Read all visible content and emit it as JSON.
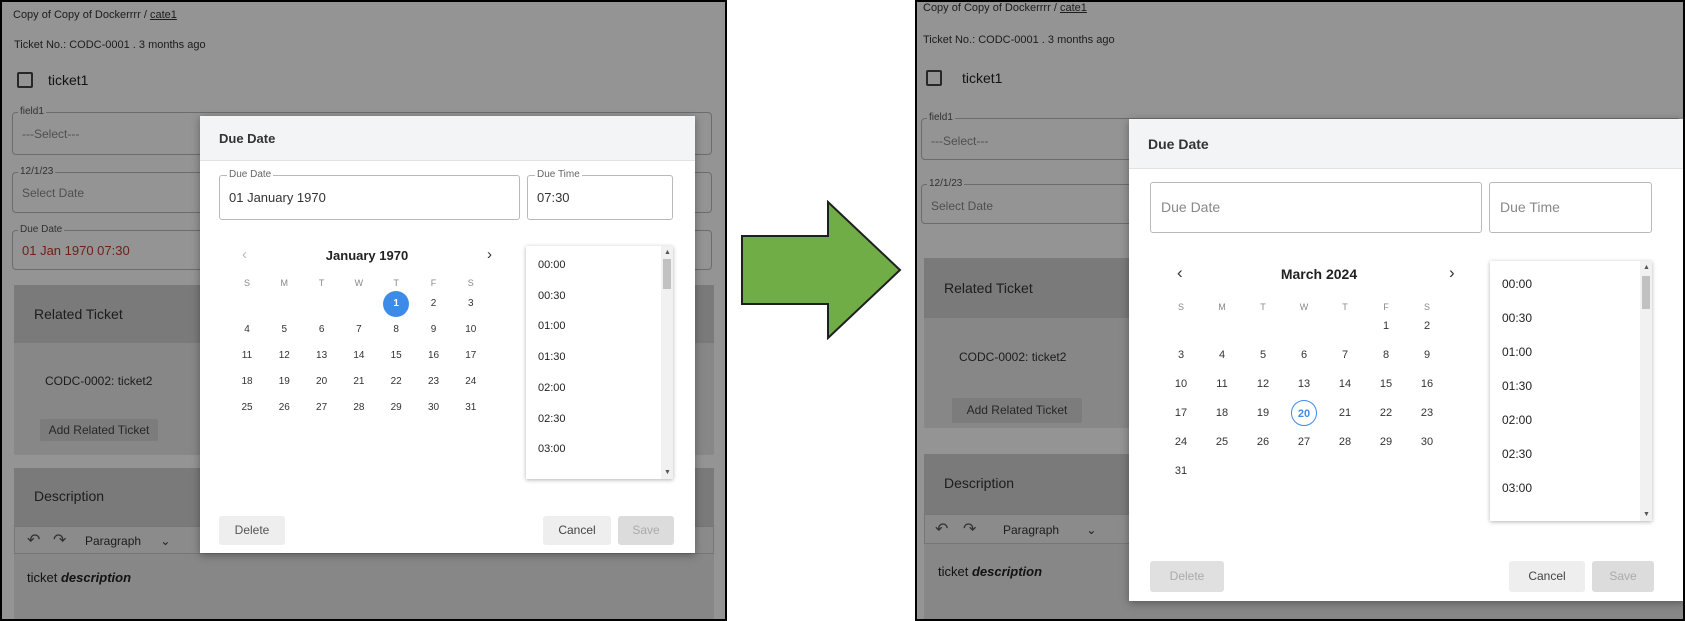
{
  "app": {
    "breadcrumb_project": "Copy of Copy of Dockerrrr",
    "breadcrumb_sep": "/",
    "breadcrumb_category": "cate1",
    "ticket_line": "Ticket No.: CODC-0001 . 3 months ago",
    "ticket_title": "ticket1",
    "field1_label": "field1",
    "field1_value": "---Select---",
    "date_field_label": "12/1/23",
    "date_field_value": "Select Date",
    "due_field_label": "Due Date",
    "due_field_value": "01 Jan 1970 07:30",
    "related_title": "Related Ticket",
    "related_item": "CODC-0002: ticket2",
    "add_related": "Add Related Ticket",
    "desc_title": "Description",
    "paragraph": "Paragraph",
    "desc_text_plain": "ticket ",
    "desc_text_em": "description"
  },
  "modal": {
    "title": "Due Date",
    "date_label": "Due Date",
    "time_label": "Due Time",
    "delete": "Delete",
    "cancel": "Cancel",
    "save": "Save"
  },
  "weekdays": [
    "S",
    "M",
    "T",
    "W",
    "T",
    "F",
    "S"
  ],
  "times": [
    "00:00",
    "00:30",
    "01:00",
    "01:30",
    "02:00",
    "02:30",
    "03:00"
  ],
  "before": {
    "date_value": "01 January 1970",
    "time_value": "07:30",
    "month_label": "January 1970",
    "first_weekday": 4,
    "days_in_month": 31,
    "selected_day": 1
  },
  "after": {
    "date_placeholder": "Due Date",
    "time_placeholder": "Due Time",
    "month_label": "March 2024",
    "first_weekday": 5,
    "days_in_month": 31,
    "today_day": 20
  },
  "colors": {
    "accent": "#3d8be8",
    "arrow_fill": "#70ad47",
    "due_red": "#c0392b"
  },
  "icons": {
    "prev": "chevron-left-icon",
    "next": "chevron-right-icon",
    "undo": "undo-icon",
    "redo": "redo-icon",
    "arrow": "right-arrow-icon"
  }
}
